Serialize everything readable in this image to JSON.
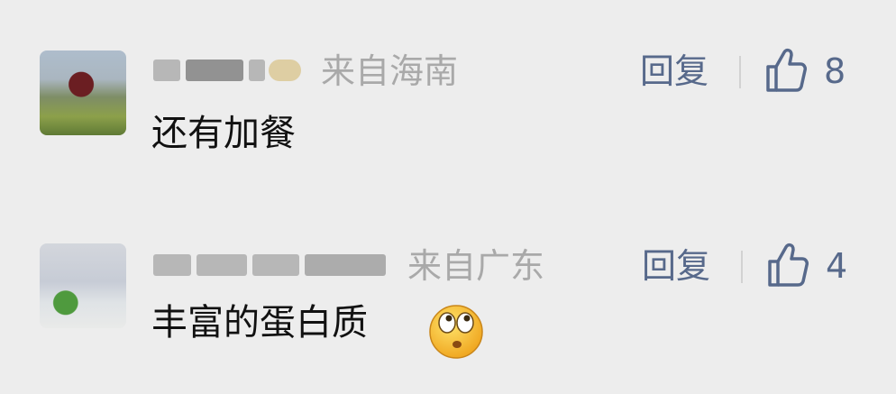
{
  "comments": [
    {
      "location": "来自海南",
      "reply_label": "回复",
      "likes": "8",
      "text": "还有加餐",
      "avatar_icon": "user-avatar-photo",
      "name_blurred": true
    },
    {
      "location": "来自广东",
      "reply_label": "回复",
      "likes": "4",
      "text": "丰富的蛋白质",
      "avatar_icon": "user-avatar-photo",
      "name_blurred": true,
      "emoji": "rolling-eyes-emoji-icon"
    }
  ],
  "colors": {
    "background": "#ededed",
    "accent": "#57698b",
    "location": "#a9a9a9",
    "text": "#111111"
  }
}
